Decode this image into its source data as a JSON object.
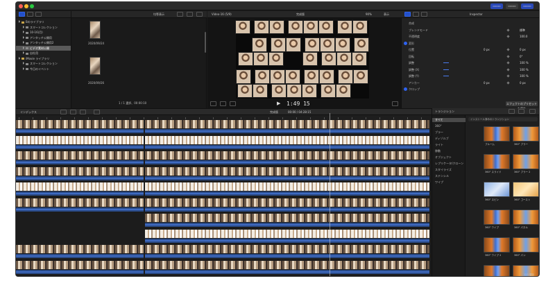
{
  "toolbar": {
    "left_buttons": [
      "library-icon",
      "photos-icon",
      "titles-icon"
    ],
    "right_buttons": [
      "▭▭▭",
      "▭▭▭",
      "▭▭▭"
    ]
  },
  "library": {
    "header_label": "",
    "items": [
      {
        "label": "Bのライブラリ",
        "level": 0,
        "icon": "star"
      },
      {
        "label": "スマートコレクション",
        "level": 1,
        "icon": "folder"
      },
      {
        "label": "10-16(月)",
        "level": 1,
        "icon": "folder"
      },
      {
        "label": "アンタッチ公開用",
        "level": 1,
        "icon": "folder"
      },
      {
        "label": "アンタッチ公開用2",
        "level": 1,
        "icon": "folder"
      },
      {
        "label": "ビデオ素材公開",
        "level": 1,
        "icon": "folder",
        "selected": true
      },
      {
        "label": "自社用",
        "level": 1,
        "icon": "folder"
      },
      {
        "label": "iMovie ライブラリ",
        "level": 0,
        "icon": "star"
      },
      {
        "label": "スマートコレクション",
        "level": 1,
        "icon": "folder"
      },
      {
        "label": "今日のイベント",
        "level": 1,
        "icon": "folder"
      }
    ]
  },
  "clips": {
    "header_label": "均等表示",
    "date1": "2020/09/24",
    "date2": "2020/09/26",
    "footer_label": "1 / 1 選択、00:00:10"
  },
  "viewer": {
    "title": "Video-16 (5/9)",
    "subtitle": "完成版",
    "zoom": "90%",
    "view_label": "表示",
    "timecode": "1:49 15"
  },
  "inspector": {
    "header_label": "Inspector",
    "rows": [
      {
        "label": "合成",
        "value": ""
      },
      {
        "label": "ブレンドモード",
        "value": "標準"
      },
      {
        "label": "不透明度",
        "value": "100.0"
      },
      {
        "label": "変形",
        "value": "",
        "section": true
      },
      {
        "label": "位置",
        "value": "0 px",
        "value2": "0 px"
      },
      {
        "label": "回転",
        "value": "0°"
      },
      {
        "label": "調整",
        "value": "100 %"
      },
      {
        "label": "調整 (X)",
        "value": "100 %"
      },
      {
        "label": "調整 (Y)",
        "value": "100 %"
      },
      {
        "label": "アンカー",
        "value": "0 px",
        "value2": "0 px"
      },
      {
        "label": "クロップ",
        "value": "",
        "section": true
      }
    ],
    "save_button": "エフェクトのプリセットを保存"
  },
  "timeline": {
    "index_label": "インデックス",
    "project_label": "完成版",
    "duration_label": "00:00 / 04:28:15",
    "tracks": 10
  },
  "effects": {
    "header_label": "トランジション",
    "search_placeholder": "インストール済みのトランジション",
    "categories": [
      "すべて",
      "360°",
      "ブラー",
      "ディゾルブ",
      "ライト",
      "移動",
      "オブジェクト",
      "レプリケータ/クローン",
      "スタイライズ",
      "ステンシル",
      "ワイプ"
    ],
    "tiles": [
      {
        "label": "ブルーム",
        "style": "curtain"
      },
      {
        "label": "360° ブラー",
        "style": "curtain2"
      },
      {
        "label": "360° スライド",
        "style": "curtain"
      },
      {
        "label": "360° ブラー 2",
        "style": "curtain2"
      },
      {
        "label": "360° スピン",
        "style": "cool"
      },
      {
        "label": "360° ゴースト",
        "style": "warm"
      },
      {
        "label": "360° ワイプ",
        "style": "curtain"
      },
      {
        "label": "360° パネル",
        "style": "curtain2"
      },
      {
        "label": "360° ワイプ 2",
        "style": "curtain"
      },
      {
        "label": "360° パン",
        "style": "curtain2"
      },
      {
        "label": "360° ワープ",
        "style": "curtain"
      },
      {
        "label": "360° フェード",
        "style": "curtain2"
      }
    ],
    "count_label": "123 項目"
  }
}
